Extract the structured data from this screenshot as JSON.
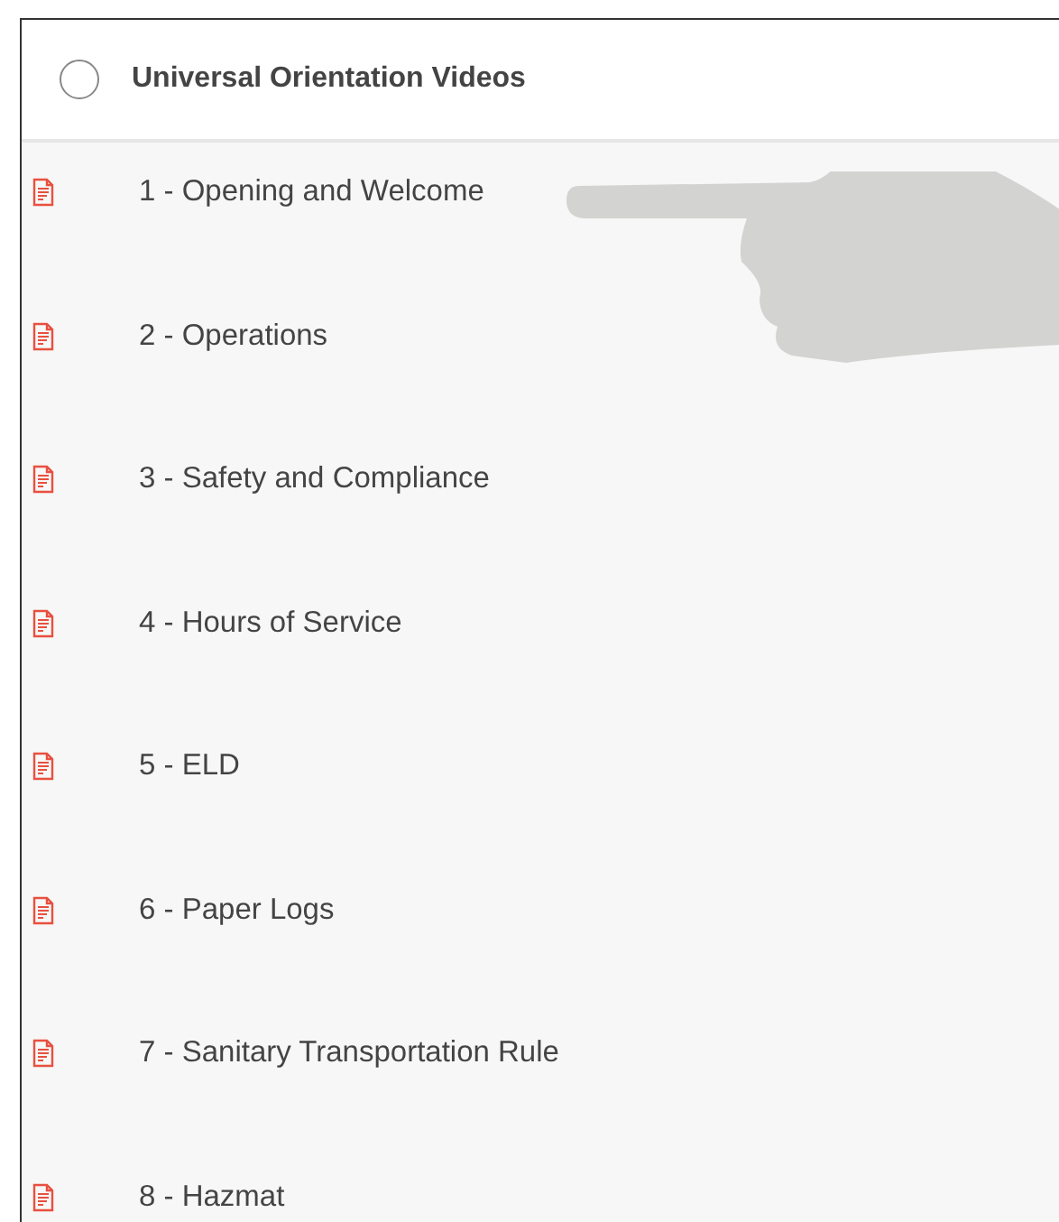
{
  "header": {
    "title": "Universal Orientation Videos",
    "checked": false
  },
  "items": [
    {
      "label": "1 - Opening and Welcome"
    },
    {
      "label": "2 - Operations"
    },
    {
      "label": "3 - Safety and Compliance"
    },
    {
      "label": "4 - Hours of Service"
    },
    {
      "label": "5 - ELD"
    },
    {
      "label": "6 - Paper Logs"
    },
    {
      "label": "7 - Sanitary Transportation Rule"
    },
    {
      "label": "8 - Hazmat"
    }
  ]
}
